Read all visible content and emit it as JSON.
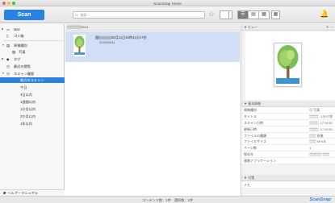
{
  "window": {
    "title": "ScanSnap Home"
  },
  "toolbar": {
    "scan_label": "Scan",
    "search_placeholder": "Q~ 検索",
    "view_icons": [
      "☰",
      "▤",
      "▦"
    ]
  },
  "sidebar": {
    "items": [
      {
        "label": "Mac",
        "icon": "computer-icon",
        "glyph": "▭"
      },
      {
        "label": "ゴミ箱",
        "icon": "trash-icon",
        "glyph": "▯"
      },
      {
        "label": "原稿種別",
        "icon": "document-type-icon",
        "glyph": "▤"
      },
      {
        "label": "写真",
        "icon": "photo-icon",
        "glyph": "▨"
      },
      {
        "label": "タグ",
        "icon": "tag-icon",
        "glyph": "◆"
      },
      {
        "label": "最近の閲覧",
        "icon": "recent-icon",
        "glyph": "◷"
      },
      {
        "label": "スキャン履歴",
        "icon": "history-icon",
        "glyph": "◷"
      },
      {
        "label": "最近のスキャン"
      },
      {
        "label": "今日"
      },
      {
        "label": "3日以内"
      },
      {
        "label": "1週間以内"
      },
      {
        "label": "1か月以内"
      },
      {
        "label": "3か月以内"
      },
      {
        "label": "1年以内"
      }
    ],
    "help_label": "ヘルプ・マニュアル"
  },
  "center": {
    "group_header": "▒▒▒▒▒▒05/11",
    "row": {
      "title": "▒▒▒▒▒05月11日16時41分17秒",
      "date": "2020/05/11"
    }
  },
  "right_panel": {
    "preview_header": "ビュー",
    "props_header": "基本情報",
    "properties": [
      {
        "key": "原稿種別",
        "value": "▨ 写真"
      },
      {
        "key": "タイトル",
        "value": "▒▒▒▒...1分17秒"
      },
      {
        "key": "スキャン日時",
        "value": "▒▒▒▒, 17:16:51"
      },
      {
        "key": "更新日時",
        "value": "▒▒▒▒, 17:16:51"
      },
      {
        "key": "ファイルの種類",
        "value": "▒▒▒ 画像"
      },
      {
        "key": "ファイルサイズ",
        "value": "▒▒▒ 69 KB"
      },
      {
        "key": "ページ数",
        "value": "1"
      },
      {
        "key": "保存先",
        "value": "▒▒/▒▒▒ ▒▒▒"
      },
      {
        "key": "連携アプリケーション",
        "value": ""
      }
    ],
    "memo_header": "付箋",
    "memo_label": "メモ"
  },
  "statusbar": {
    "text": "コンテンツ数：1件　選択数：1件",
    "logo": "ScanSnap"
  },
  "colors": {
    "accent": "#2a83e0",
    "selected_row": "#d0dff5",
    "sidebar_bg": "#f7f7f7"
  }
}
